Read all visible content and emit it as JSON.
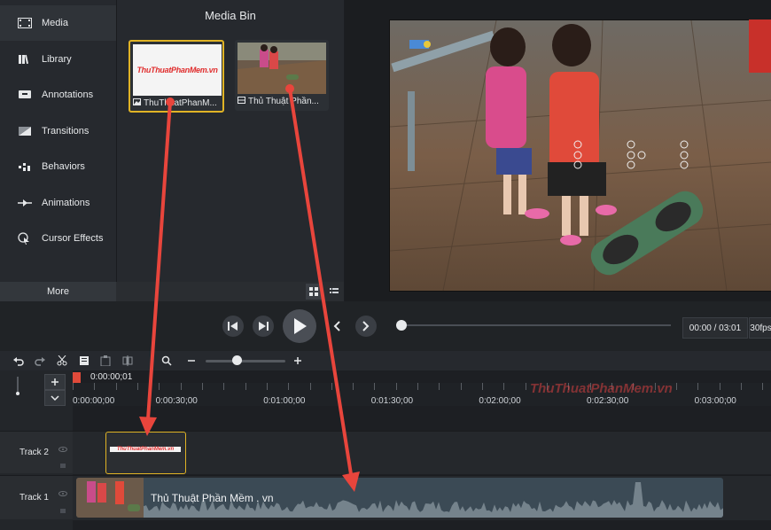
{
  "sidebar": {
    "items": [
      {
        "label": "Media",
        "icon": "film-icon"
      },
      {
        "label": "Library",
        "icon": "library-icon"
      },
      {
        "label": "Annotations",
        "icon": "annotation-icon"
      },
      {
        "label": "Transitions",
        "icon": "transition-icon"
      },
      {
        "label": "Behaviors",
        "icon": "behavior-icon"
      },
      {
        "label": "Animations",
        "icon": "animation-icon"
      },
      {
        "label": "Cursor Effects",
        "icon": "cursor-icon"
      }
    ],
    "more_label": "More",
    "add_label": "+"
  },
  "media_bin": {
    "title": "Media Bin",
    "items": [
      {
        "label": "ThuThuatPhanM...",
        "logo_text": "ThuThuatPhanMem.vn",
        "type": "image"
      },
      {
        "label": "Thủ Thuật Phần...",
        "type": "video"
      }
    ]
  },
  "playback": {
    "time": "00:00 / 03:01",
    "fps": "30fps"
  },
  "timeline": {
    "playhead_time": "0:00:00;01",
    "ticks": [
      "0:00:00;00",
      "0:00:30;00",
      "0:01:00;00",
      "0:01:30;00",
      "0:02:00;00",
      "0:02:30;00",
      "0:03:00;00"
    ],
    "watermark": "ThuThuatPhanMem.vn",
    "tracks": [
      {
        "name": "Track 2",
        "clip_logo": "ThuThuatPhanMem.vn"
      },
      {
        "name": "Track 1",
        "clip_label": "Thủ Thuật Phần Mềm . vn"
      }
    ]
  },
  "colors": {
    "accent": "#e0b325",
    "arrow": "#e8453c",
    "playhead": "#e04a3a"
  }
}
